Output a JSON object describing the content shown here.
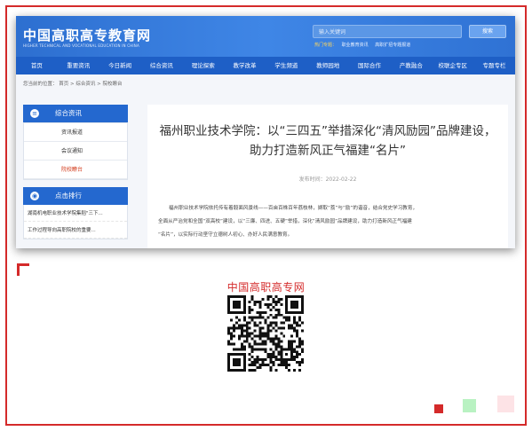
{
  "header": {
    "logo_title": "中国高职高专教育网",
    "logo_subtitle": "HIGHER TECHNICAL AND VOCATIONAL EDUCATION IN CHINA",
    "search_placeholder": "输入关键词",
    "search_button": "搜索",
    "hot_label": "热门专题：",
    "hot_links": [
      "职业教育资讯",
      "高职扩招专题报道"
    ]
  },
  "nav": {
    "items": [
      "首页",
      "重要资讯",
      "今日新闻",
      "综合资讯",
      "理论探索",
      "教学改革",
      "学生频道",
      "教师园地",
      "国际合作",
      "产教融合",
      "校联企专区",
      "专题专栏"
    ]
  },
  "breadcrumb": "您当前的位置： 首页 > 综合资讯 > 院校瞭台",
  "sidebar": {
    "box1_title": "综合资讯",
    "box1_links": [
      "资讯报道",
      "会议通知",
      "院校瞭台"
    ],
    "box2_title": "点击排行",
    "rank_items": [
      "湖南机电职业技术学院集稻\"三下...",
      "工作过程导向高职院校的重要..."
    ]
  },
  "article": {
    "title_line1": "福州职业技术学院：以“三四五”举措深化“清风励园”品牌建设，",
    "title_line2": "助力打造新风正气福建“名片”",
    "date": "发布时间：2022-02-22",
    "paragraph1": "福州职业技术学院依托传有着毅面风景线——百亩百株百年荔枝林，撷取“荔”与“励”的谐音，结合党史学习教育，",
    "paragraph2": "全面从严治党和全国“双高校”建设，以“三廉、四进、五硬”举措，深化“清风励园”品牌建设，助力打造新风正气福建",
    "paragraph3": "“名片”，以实际行动坚守立德树人初心、办好人民满意教育。"
  },
  "caption": "中国高职高专网",
  "colors": {
    "accent_red": "#d42a2a",
    "header_blue": "#2d6fd0",
    "nav_blue": "#1e5fc6"
  }
}
